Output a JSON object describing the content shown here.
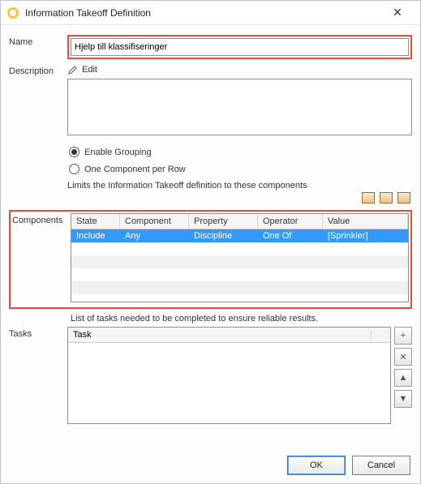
{
  "window": {
    "title": "Information Takeoff Definition"
  },
  "labels": {
    "name": "Name",
    "description": "Description",
    "edit": "Edit",
    "components": "Components",
    "tasks": "Tasks",
    "limits_hint": "Limits the Information Takeoff definition to these components",
    "tasks_hint": "List of tasks needed to be completed to ensure reliable results."
  },
  "name_value": "Hjelp till klassifiseringer",
  "grouping": {
    "enable_label": "Enable Grouping",
    "one_per_row_label": "One Component per Row",
    "selected": "enable"
  },
  "components_table": {
    "headers": {
      "state": "State",
      "component": "Component",
      "property": "Property",
      "operator": "Operator",
      "value": "Value"
    },
    "rows": [
      {
        "state": "Include",
        "component": "Any",
        "property": "Discipline",
        "operator": "One Of",
        "value": "[Sprinkler]"
      }
    ]
  },
  "tasks_table": {
    "header": "Task"
  },
  "buttons": {
    "ok": "OK",
    "cancel": "Cancel",
    "add": "+",
    "remove": "✕",
    "up": "▲",
    "down": "▼"
  }
}
